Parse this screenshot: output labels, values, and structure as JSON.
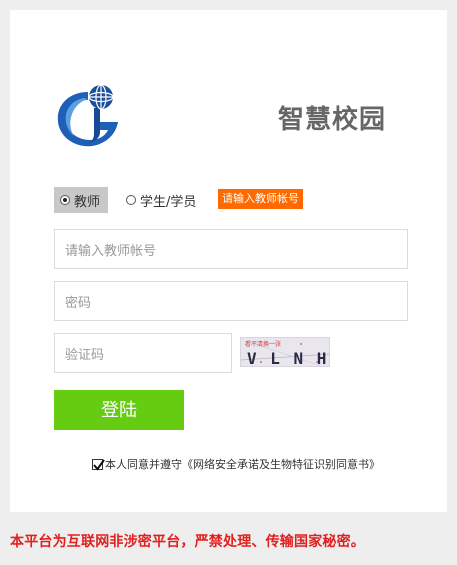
{
  "app": {
    "title": "智慧校园"
  },
  "login_form": {
    "roles": [
      {
        "label": "教师",
        "selected": true
      },
      {
        "label": "学生/学员",
        "selected": false
      }
    ],
    "role_hint": "请输入教师帐号",
    "account_placeholder": "请输入教师帐号",
    "password_placeholder": "密码",
    "captcha_placeholder": "验证码",
    "captcha_image_caption": "看不清换一张",
    "captcha_image_text": "V L N H",
    "login_button": "登陆",
    "agreement": {
      "checked": true,
      "text": "本人同意并遵守《网络安全承诺及生物特征识别同意书》"
    }
  },
  "footer": {
    "notice": "本平台为互联网非涉密平台，严禁处理、传输国家秘密。"
  },
  "colors": {
    "login_button": "#66cc11",
    "hint_badge": "#ff6a00",
    "notice_text": "#e02020",
    "title_text": "#666666",
    "logo_blue": "#1f5fb8"
  },
  "icons": {
    "logo": "school-logo-icon",
    "radio": "radio-icon",
    "checkbox": "checkbox-icon"
  }
}
